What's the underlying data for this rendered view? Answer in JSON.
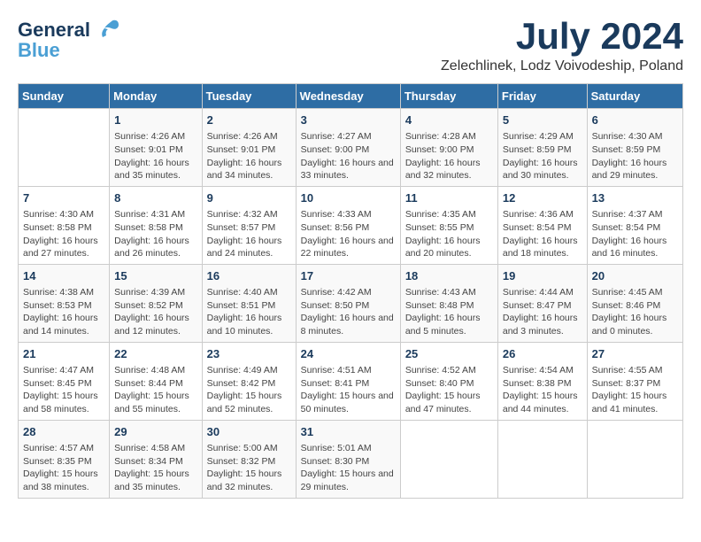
{
  "header": {
    "logo_line1": "General",
    "logo_line2": "Blue",
    "month_year": "July 2024",
    "location": "Zelechlinek, Lodz Voivodeship, Poland"
  },
  "weekdays": [
    "Sunday",
    "Monday",
    "Tuesday",
    "Wednesday",
    "Thursday",
    "Friday",
    "Saturday"
  ],
  "weeks": [
    [
      {
        "day": "",
        "info": ""
      },
      {
        "day": "1",
        "info": "Sunrise: 4:26 AM\nSunset: 9:01 PM\nDaylight: 16 hours and 35 minutes."
      },
      {
        "day": "2",
        "info": "Sunrise: 4:26 AM\nSunset: 9:01 PM\nDaylight: 16 hours and 34 minutes."
      },
      {
        "day": "3",
        "info": "Sunrise: 4:27 AM\nSunset: 9:00 PM\nDaylight: 16 hours and 33 minutes."
      },
      {
        "day": "4",
        "info": "Sunrise: 4:28 AM\nSunset: 9:00 PM\nDaylight: 16 hours and 32 minutes."
      },
      {
        "day": "5",
        "info": "Sunrise: 4:29 AM\nSunset: 8:59 PM\nDaylight: 16 hours and 30 minutes."
      },
      {
        "day": "6",
        "info": "Sunrise: 4:30 AM\nSunset: 8:59 PM\nDaylight: 16 hours and 29 minutes."
      }
    ],
    [
      {
        "day": "7",
        "info": "Sunrise: 4:30 AM\nSunset: 8:58 PM\nDaylight: 16 hours and 27 minutes."
      },
      {
        "day": "8",
        "info": "Sunrise: 4:31 AM\nSunset: 8:58 PM\nDaylight: 16 hours and 26 minutes."
      },
      {
        "day": "9",
        "info": "Sunrise: 4:32 AM\nSunset: 8:57 PM\nDaylight: 16 hours and 24 minutes."
      },
      {
        "day": "10",
        "info": "Sunrise: 4:33 AM\nSunset: 8:56 PM\nDaylight: 16 hours and 22 minutes."
      },
      {
        "day": "11",
        "info": "Sunrise: 4:35 AM\nSunset: 8:55 PM\nDaylight: 16 hours and 20 minutes."
      },
      {
        "day": "12",
        "info": "Sunrise: 4:36 AM\nSunset: 8:54 PM\nDaylight: 16 hours and 18 minutes."
      },
      {
        "day": "13",
        "info": "Sunrise: 4:37 AM\nSunset: 8:54 PM\nDaylight: 16 hours and 16 minutes."
      }
    ],
    [
      {
        "day": "14",
        "info": "Sunrise: 4:38 AM\nSunset: 8:53 PM\nDaylight: 16 hours and 14 minutes."
      },
      {
        "day": "15",
        "info": "Sunrise: 4:39 AM\nSunset: 8:52 PM\nDaylight: 16 hours and 12 minutes."
      },
      {
        "day": "16",
        "info": "Sunrise: 4:40 AM\nSunset: 8:51 PM\nDaylight: 16 hours and 10 minutes."
      },
      {
        "day": "17",
        "info": "Sunrise: 4:42 AM\nSunset: 8:50 PM\nDaylight: 16 hours and 8 minutes."
      },
      {
        "day": "18",
        "info": "Sunrise: 4:43 AM\nSunset: 8:48 PM\nDaylight: 16 hours and 5 minutes."
      },
      {
        "day": "19",
        "info": "Sunrise: 4:44 AM\nSunset: 8:47 PM\nDaylight: 16 hours and 3 minutes."
      },
      {
        "day": "20",
        "info": "Sunrise: 4:45 AM\nSunset: 8:46 PM\nDaylight: 16 hours and 0 minutes."
      }
    ],
    [
      {
        "day": "21",
        "info": "Sunrise: 4:47 AM\nSunset: 8:45 PM\nDaylight: 15 hours and 58 minutes."
      },
      {
        "day": "22",
        "info": "Sunrise: 4:48 AM\nSunset: 8:44 PM\nDaylight: 15 hours and 55 minutes."
      },
      {
        "day": "23",
        "info": "Sunrise: 4:49 AM\nSunset: 8:42 PM\nDaylight: 15 hours and 52 minutes."
      },
      {
        "day": "24",
        "info": "Sunrise: 4:51 AM\nSunset: 8:41 PM\nDaylight: 15 hours and 50 minutes."
      },
      {
        "day": "25",
        "info": "Sunrise: 4:52 AM\nSunset: 8:40 PM\nDaylight: 15 hours and 47 minutes."
      },
      {
        "day": "26",
        "info": "Sunrise: 4:54 AM\nSunset: 8:38 PM\nDaylight: 15 hours and 44 minutes."
      },
      {
        "day": "27",
        "info": "Sunrise: 4:55 AM\nSunset: 8:37 PM\nDaylight: 15 hours and 41 minutes."
      }
    ],
    [
      {
        "day": "28",
        "info": "Sunrise: 4:57 AM\nSunset: 8:35 PM\nDaylight: 15 hours and 38 minutes."
      },
      {
        "day": "29",
        "info": "Sunrise: 4:58 AM\nSunset: 8:34 PM\nDaylight: 15 hours and 35 minutes."
      },
      {
        "day": "30",
        "info": "Sunrise: 5:00 AM\nSunset: 8:32 PM\nDaylight: 15 hours and 32 minutes."
      },
      {
        "day": "31",
        "info": "Sunrise: 5:01 AM\nSunset: 8:30 PM\nDaylight: 15 hours and 29 minutes."
      },
      {
        "day": "",
        "info": ""
      },
      {
        "day": "",
        "info": ""
      },
      {
        "day": "",
        "info": ""
      }
    ]
  ]
}
